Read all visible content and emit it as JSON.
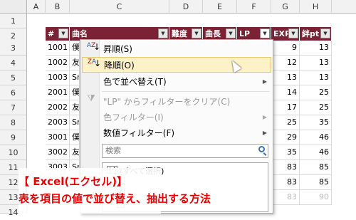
{
  "columns": [
    "A",
    "B",
    "C",
    "D",
    "E",
    "F",
    "G",
    "H"
  ],
  "rows": [
    "1",
    "2",
    "3",
    "4",
    "5",
    "6",
    "7",
    "8",
    "9",
    "10",
    "11",
    "12",
    "13",
    "14",
    "15"
  ],
  "header": [
    "#",
    "曲名",
    "難度",
    "曲長",
    "LP",
    "EXP",
    "絆pt"
  ],
  "table": [
    {
      "num": "1001",
      "name": "僕",
      "exp": "9",
      "pt": "13"
    },
    {
      "num": "1002",
      "name": "友",
      "exp": "12",
      "pt": "13"
    },
    {
      "num": "1003",
      "name": "Sn",
      "exp": "13",
      "pt": "13"
    },
    {
      "num": "2001",
      "name": "僕",
      "exp": "14",
      "pt": "25"
    },
    {
      "num": "2002",
      "name": "友",
      "exp": "17",
      "pt": "25"
    },
    {
      "num": "2003",
      "name": "Sn",
      "exp": "25",
      "pt": "35"
    },
    {
      "num": "3001",
      "name": "僕",
      "exp": "29",
      "pt": "46"
    },
    {
      "num": "3002",
      "name": "友",
      "exp": "35",
      "pt": "46"
    },
    {
      "num": "3003",
      "name": "Sn",
      "exp": "83",
      "pt": "85"
    },
    {
      "num": "",
      "name": "",
      "exp": "83",
      "pt": "85"
    },
    {
      "num": "",
      "name": "",
      "exp": "83",
      "pt": "90"
    }
  ],
  "menu": {
    "sort_asc": "昇順(S)",
    "sort_desc": "降順(O)",
    "sort_color": "色で並べ替え(T)",
    "clear_filter": "\"LP\" からフィルターをクリア(C)",
    "color_filter": "色フィルター(I)",
    "number_filter": "数値フィルター(F)",
    "search_placeholder": "検索",
    "select_all": "(すべて選択)"
  },
  "caption": {
    "line1": "【 Excel(エクセル)】",
    "line2": "表を項目の値で並び替え、抽出する方法"
  }
}
